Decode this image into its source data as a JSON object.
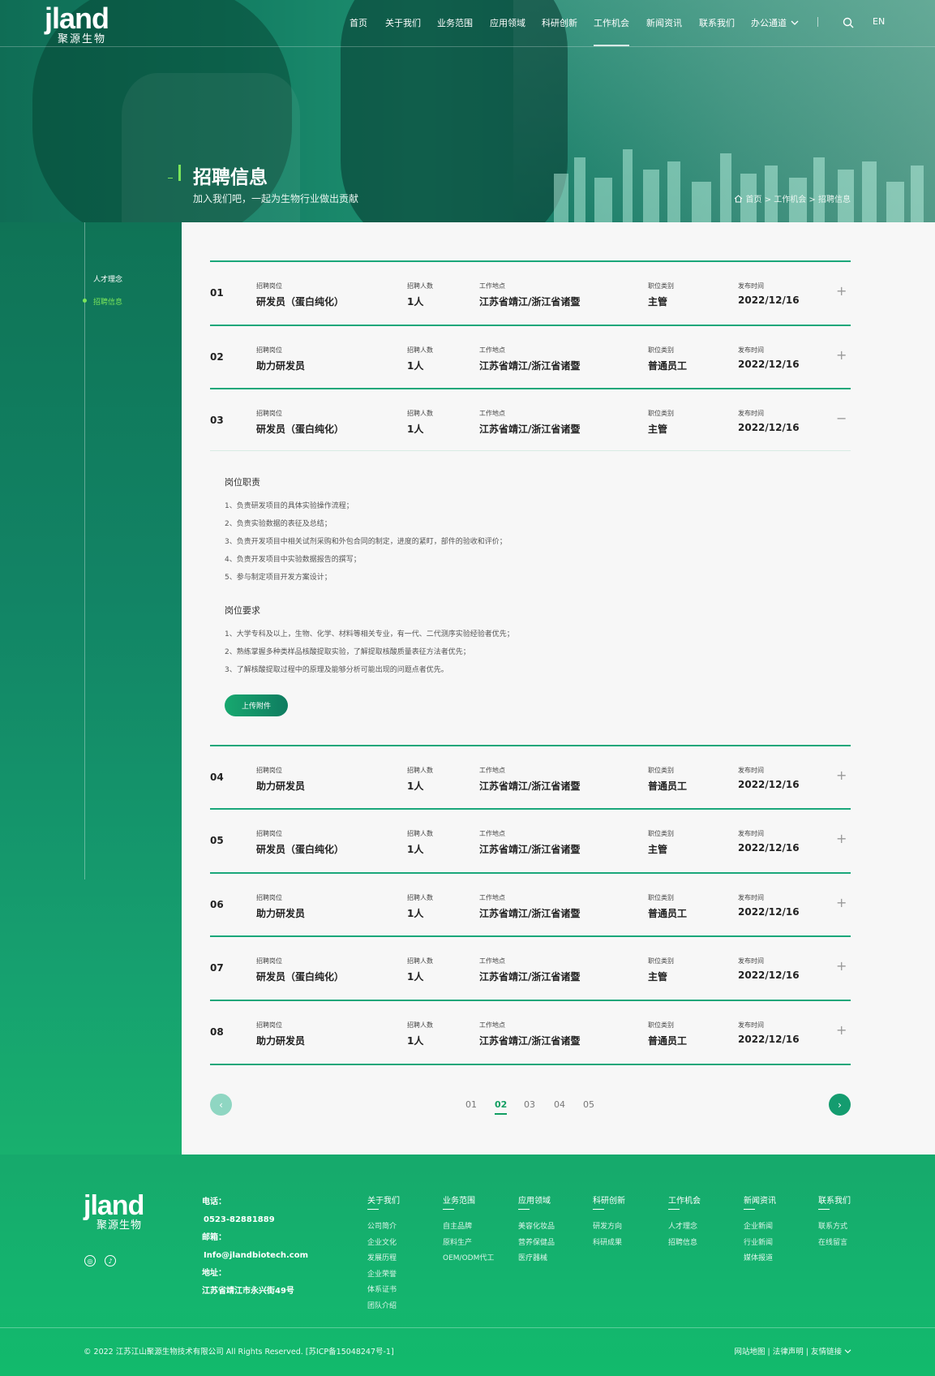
{
  "brand": {
    "logo_en": "jland",
    "logo_cn": "聚源生物"
  },
  "nav": {
    "items": [
      "首页",
      "关于我们",
      "业务范围",
      "应用领域",
      "科研创新",
      "工作机会",
      "新闻资讯",
      "联系我们",
      "办公通道"
    ],
    "active": "工作机会",
    "lang": "EN"
  },
  "hero": {
    "title": "招聘信息",
    "subtitle": "加入我们吧，一起为生物行业做出贡献",
    "breadcrumb": "首页 > 工作机会 > 招聘信息"
  },
  "sidebar": {
    "items": [
      "人才理念",
      "招聘信息"
    ],
    "active": "招聘信息"
  },
  "labels": {
    "position": "招聘岗位",
    "count": "招聘人数",
    "location": "工作地点",
    "category": "职位类别",
    "date": "发布时间"
  },
  "jobs": [
    {
      "no": "01",
      "title": "研发员（蛋白纯化）",
      "count": "1人",
      "location": "江苏省靖江/浙江省诸暨",
      "category": "主管",
      "date": "2022/12/16",
      "toggle": "+"
    },
    {
      "no": "02",
      "title": "助力研发员",
      "count": "1人",
      "location": "江苏省靖江/浙江省诸暨",
      "category": "普通员工",
      "date": "2022/12/16",
      "toggle": "+"
    },
    {
      "no": "03",
      "title": "研发员（蛋白纯化）",
      "count": "1人",
      "location": "江苏省靖江/浙江省诸暨",
      "category": "主管",
      "date": "2022/12/16",
      "toggle": "−"
    },
    {
      "no": "04",
      "title": "助力研发员",
      "count": "1人",
      "location": "江苏省靖江/浙江省诸暨",
      "category": "普通员工",
      "date": "2022/12/16",
      "toggle": "+"
    },
    {
      "no": "05",
      "title": "研发员（蛋白纯化）",
      "count": "1人",
      "location": "江苏省靖江/浙江省诸暨",
      "category": "主管",
      "date": "2022/12/16",
      "toggle": "+"
    },
    {
      "no": "06",
      "title": "助力研发员",
      "count": "1人",
      "location": "江苏省靖江/浙江省诸暨",
      "category": "普通员工",
      "date": "2022/12/16",
      "toggle": "+"
    },
    {
      "no": "07",
      "title": "研发员（蛋白纯化）",
      "count": "1人",
      "location": "江苏省靖江/浙江省诸暨",
      "category": "主管",
      "date": "2022/12/16",
      "toggle": "+"
    },
    {
      "no": "08",
      "title": "助力研发员",
      "count": "1人",
      "location": "江苏省靖江/浙江省诸暨",
      "category": "普通员工",
      "date": "2022/12/16",
      "toggle": "+"
    }
  ],
  "detail": {
    "duty_title": "岗位职责",
    "duties": [
      "1、负责研发项目的具体实验操作流程；",
      "2、负责实验数据的表征及总结；",
      "3、负责开发项目中相关试剂采购和外包合同的制定，进度的紧盯，部件的验收和评价；",
      "4、负责开发项目中实验数据报告的撰写；",
      "5、参与制定项目开发方案设计；"
    ],
    "req_title": "岗位要求",
    "reqs": [
      "1、大学专科及以上，生物、化学、材料等相关专业，有一代、二代测序实验经验者优先；",
      "2、熟练掌握多种类样品核酸提取实验，了解提取核酸质量表征方法者优先；",
      "3、了解核酸提取过程中的原理及能够分析可能出现的问题点者优先。"
    ],
    "upload_label": "上传附件"
  },
  "pager": {
    "pages": [
      "01",
      "02",
      "03",
      "04",
      "05"
    ],
    "current": "02",
    "prev": "‹",
    "next": "›"
  },
  "footer": {
    "phone_label": "电话：",
    "phone": "0523-82881889",
    "email_label": "邮箱：",
    "email": "Info@jlandbiotech.com",
    "addr_label": "地址：",
    "addr": "江苏省靖江市永兴街49号",
    "cols": [
      {
        "h": "关于我们",
        "links": [
          "公司简介",
          "企业文化",
          "发展历程",
          "企业荣誉",
          "体系证书",
          "团队介绍"
        ]
      },
      {
        "h": "业务范围",
        "links": [
          "自主品牌",
          "原料生产",
          "OEM/ODM代工"
        ]
      },
      {
        "h": "应用领域",
        "links": [
          "美容化妆品",
          "营养保健品",
          "医疗器械"
        ]
      },
      {
        "h": "科研创新",
        "links": [
          "研发方向",
          "科研成果"
        ]
      },
      {
        "h": "工作机会",
        "links": [
          "人才理念",
          "招聘信息"
        ]
      },
      {
        "h": "新闻资讯",
        "links": [
          "企业新闻",
          "行业新闻",
          "媒体报道"
        ]
      },
      {
        "h": "联系我们",
        "links": [
          "联系方式",
          "在线留言"
        ]
      }
    ],
    "copyright": "© 2022 江苏江山聚源生物技术有限公司 All Rights Reserved. [苏ICP备15048247号-1]",
    "links": "网站地图 | 法律声明 | 友情链接"
  },
  "colors": {
    "primary": "#149c6f",
    "accent": "#7be55b"
  }
}
